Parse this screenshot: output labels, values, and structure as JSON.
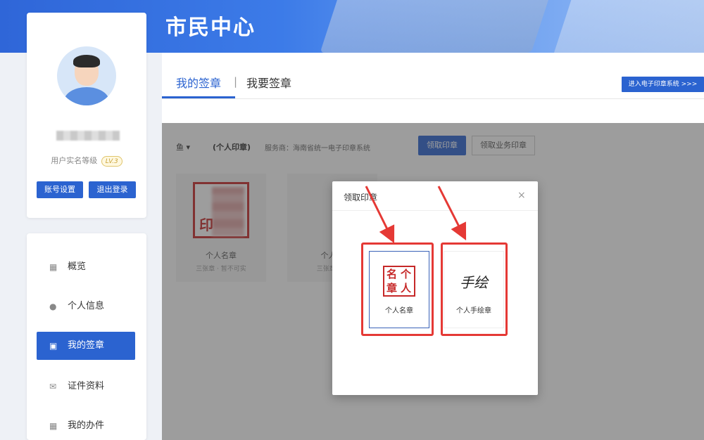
{
  "banner": {
    "title": "市民中心"
  },
  "profile": {
    "level_label": "用户实名等级",
    "level_badge": "LV.3",
    "account_settings": "账号设置",
    "logout": "退出登录"
  },
  "nav": {
    "items": [
      {
        "label": "概览",
        "icon": "grid-icon"
      },
      {
        "label": "个人信息",
        "icon": "user-icon"
      },
      {
        "label": "我的签章",
        "icon": "id-card-icon",
        "active": true
      },
      {
        "label": "证件资料",
        "icon": "envelope-icon"
      },
      {
        "label": "我的办件",
        "icon": "apps-icon"
      }
    ]
  },
  "tabs": {
    "my_seals": "我的签章",
    "want_seal": "我要签章",
    "enter_system": "进入电子印章系统 >>>"
  },
  "filter": {
    "type_prefix": "鱼 ▾",
    "type_label": "(个人印章)",
    "provider": "服务商：海南省统一电子印章系统",
    "claim_button": "领取印章",
    "claim_business_button": "领取业务印章"
  },
  "seal_cards": [
    {
      "title": "个人名章",
      "seal_char": "印",
      "subtitle": "三张章 · 暂不可实"
    },
    {
      "title": "个人手",
      "subtitle": "三张章 · 可"
    }
  ],
  "modal": {
    "title": "领取印章",
    "close": "×",
    "options": [
      {
        "label": "个人名章",
        "seal_chars": [
          "名",
          "个",
          "章",
          "人"
        ]
      },
      {
        "label": "个人手绘章",
        "handwriting": "手绘"
      }
    ]
  },
  "colors": {
    "primary": "#2b63d0",
    "highlight": "#e53935",
    "seal_red": "#c62828"
  }
}
